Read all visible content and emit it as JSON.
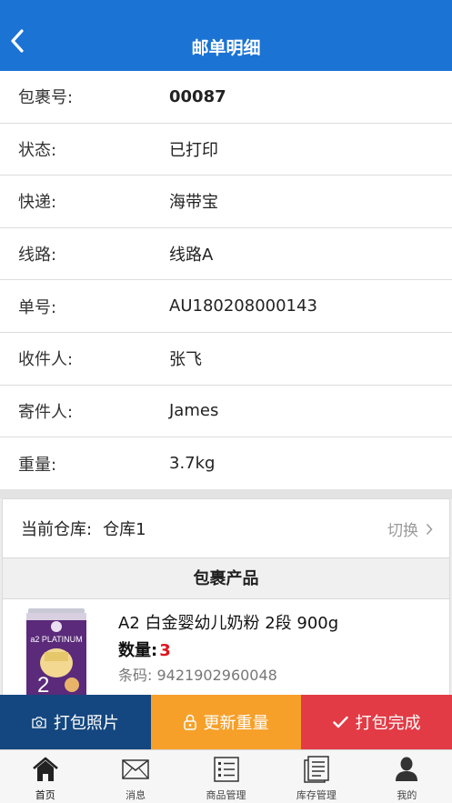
{
  "header": {
    "title": "邮单明细",
    "back_icon": "chevron-left-icon"
  },
  "details": [
    {
      "label": "包裹号:",
      "value": "00087"
    },
    {
      "label": "状态:",
      "value": "已打印"
    },
    {
      "label": "快递:",
      "value": "海带宝"
    },
    {
      "label": "线路:",
      "value": "线路A"
    },
    {
      "label": "单号:",
      "value": "AU180208000143"
    },
    {
      "label": "收件人:",
      "value": "张飞"
    },
    {
      "label": "寄件人:",
      "value": "James"
    },
    {
      "label": "重量:",
      "value": "3.7kg"
    }
  ],
  "warehouse": {
    "label": "当前仓库:",
    "value": "仓库1",
    "switch_label": "切换"
  },
  "products_section": {
    "title": "包裹产品"
  },
  "products": [
    {
      "name": "A2 白金婴幼儿奶粉 2段 900g",
      "qty_label": "数量:",
      "qty": "3",
      "barcode_label": "条码:",
      "barcode": "9421902960048",
      "image_text": "a2 PLATINUM",
      "image_stage": "2"
    }
  ],
  "actions": {
    "photo_label": "打包照片",
    "weight_label": "更新重量",
    "done_label": "打包完成"
  },
  "tabs": [
    {
      "label": "首页",
      "icon": "home-icon",
      "active": true
    },
    {
      "label": "消息",
      "icon": "mail-icon",
      "active": false
    },
    {
      "label": "商品管理",
      "icon": "list-icon",
      "active": false
    },
    {
      "label": "库存管理",
      "icon": "document-icon",
      "active": false
    },
    {
      "label": "我的",
      "icon": "user-icon",
      "active": false
    }
  ],
  "colors": {
    "nav": "#1b73d4",
    "photo_button": "#14477f",
    "weight_button": "#f6a02a",
    "done_button": "#e23b45",
    "qty_red": "#e0141e"
  }
}
